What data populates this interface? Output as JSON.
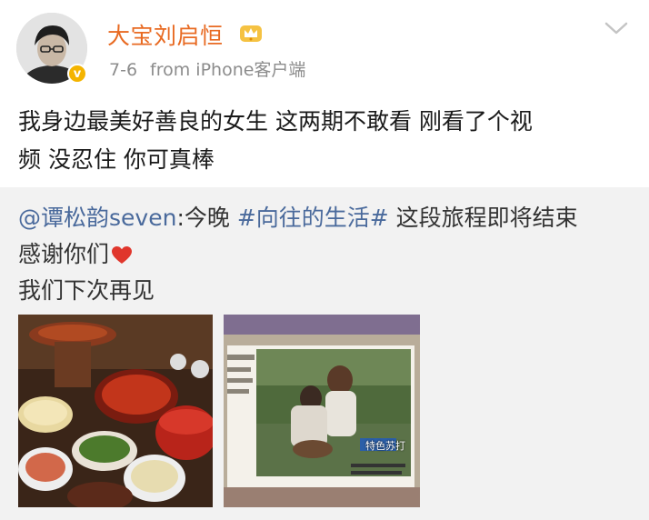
{
  "header": {
    "username": "大宝刘启恒",
    "date": "7-6",
    "source": "from iPhone客户端",
    "verified_mark": "v"
  },
  "post": {
    "line1": "我身边最美好善良的女生 这两期不敢看 刚看了个视",
    "line2": "频 没忍住 你可真棒"
  },
  "repost": {
    "mention": "@谭松韵seven",
    "sep": ":今晚 ",
    "hashtag": "#向往的生活#",
    "rest": " 这段旅程即将结束",
    "line2": "感谢你们",
    "line3": "我们下次再见"
  },
  "images": [
    {
      "icon": "hotpot-photo"
    },
    {
      "icon": "tv-screenshot-photo",
      "caption": "特色苏打"
    }
  ],
  "colors": {
    "username": "#e86a22",
    "link": "#4a6a9c",
    "meta": "#8c8c8c",
    "repost_bg": "#f2f2f2"
  }
}
